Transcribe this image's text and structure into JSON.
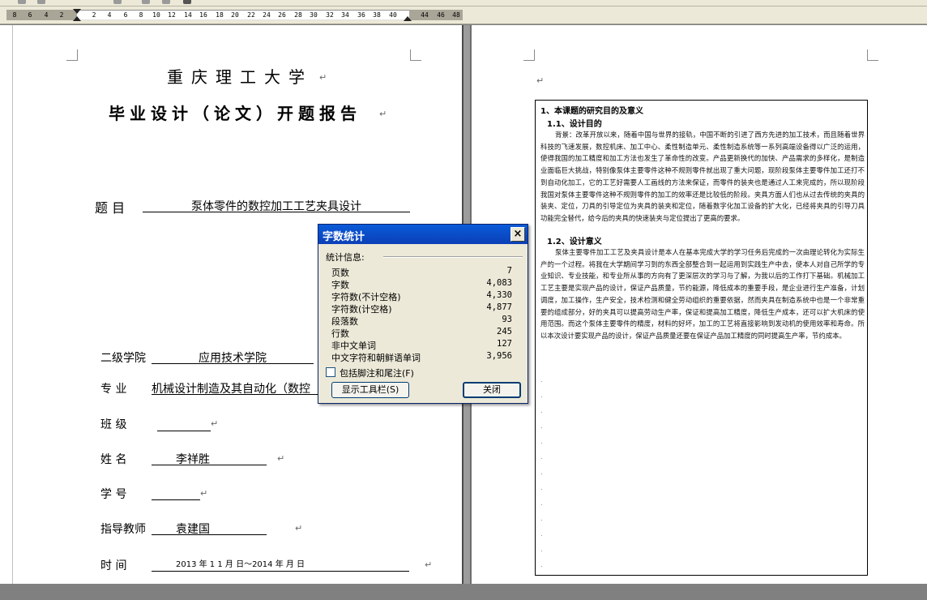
{
  "ruler": {
    "ticks": [
      "8",
      "6",
      "4",
      "2",
      "2",
      "4",
      "6",
      "8",
      "10",
      "12",
      "14",
      "16",
      "18",
      "20",
      "22",
      "24",
      "26",
      "28",
      "30",
      "32",
      "34",
      "36",
      "38",
      "40",
      "44",
      "46",
      "48"
    ]
  },
  "left_page": {
    "university": "重庆理工大学",
    "report_title": "毕业设计（论文）开题报告",
    "topic_label": "题    目",
    "topic_value": "泵体零件的数控加工工艺夹具设计",
    "college_label": "二级学院",
    "college_value": "应用技术学院",
    "major_label": "专    业",
    "major_value": "机械设计制造及其自动化（数控",
    "class_label": "班    级",
    "name_label": "姓    名",
    "name_value": "李祥胜",
    "student_id_label": "学    号",
    "advisor_label": "指导教师",
    "advisor_value": "袁建国",
    "time_label": "时    间",
    "time_value": "2013 年   1 1 月   日～2014 年   月   日"
  },
  "right_page": {
    "section1": "1、本课题的研究目的及意义",
    "sub1": "1.1、设计目的",
    "para1": "背景：改革开放以来，随着中国与世界的接轨，中国不断的引进了西方先进的加工技术，而且随着世界科技的飞速发展，数控机床、加工中心、柔性制造单元、柔性制造系统等一系列高端设备得以广泛的运用，使得我国的加工精度和加工方法也发生了革命性的改变。产品更新换代的加快、产品需求的多样化，是制造业面临巨大挑战，特别像泵体主要零件这种不规则零件就出现了重大问题，现阶段泵体主要零件加工还打不到自动化加工，它的工艺好需要人工画线的方法来保证，而零件的装夹也是通过人工来完成的，所以现阶段我国对泵体主要零件这种不规则零件的加工的效率还是比较低的阶段。夹具方面人们也从过去传统的夹具的装夹、定位，刀具的引导定位为夹具的装夹和定位，随着数字化加工设备的扩大化，已经将夹具的引导刀具功能完全替代，给今后的夹具的快速装夹与定位提出了更高的要求。",
    "sub2": "1.2、设计意义",
    "para2": "泵体主要零件加工工艺及夹具设计是本人在基本完成大学的学习任务后完成的一次由理论转化为实际生产的一个过程。将我在大学期间学习到的东西全部整合到一起运用到实践生产中去，使本人对自己所学的专业知识、专业技能，和专业所从事的方向有了更深层次的学习与了解，为我以后的工作打下基础。机械加工工艺主要是实现产品的设计，保证产品质量，节约能源，降低成本的重要手段，是企业进行生产准备，计划调度，加工操作，生产安全，技术检测和健全劳动组织的重要依据，然而夹具在制造系统中也是一个非常重要的组成部分，好的夹具可以提高劳动生产率，保证和提高加工精度，降低生产成本，还可以扩大机床的使用范围。而这个泵体主要零件的精度，材料的好坏，加工的工艺将直接影响到发动机的使用效率和寿命。所以本次设计要实现产品的设计，保证产品质量还要在保证产品加工精度的同时提高生产率，节约成本。"
  },
  "dialog": {
    "title": "字数统计",
    "section_label": "统计信息:",
    "rows": [
      {
        "label": "页数",
        "value": "7"
      },
      {
        "label": "字数",
        "value": "4,083"
      },
      {
        "label": "字符数(不计空格)",
        "value": "4,330"
      },
      {
        "label": "字符数(计空格)",
        "value": "4,877"
      },
      {
        "label": "段落数",
        "value": "93"
      },
      {
        "label": "行数",
        "value": "245"
      },
      {
        "label": "非中文单词",
        "value": "127"
      },
      {
        "label": "中文字符和朝鲜语单词",
        "value": "3,956"
      }
    ],
    "checkbox_label": "包括脚注和尾注(F)",
    "toolbar_button": "显示工具栏(S)",
    "close_button": "关闭",
    "close_glyph": "×"
  }
}
